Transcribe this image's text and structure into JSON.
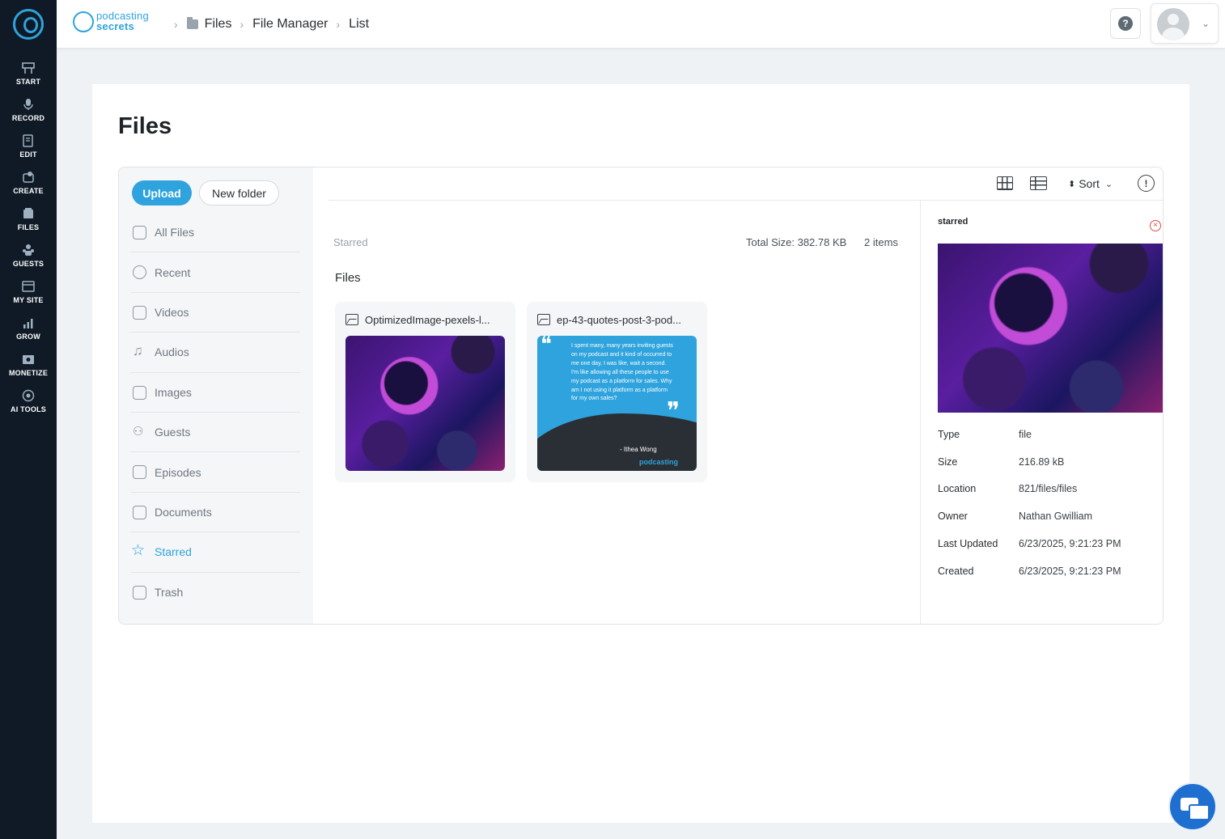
{
  "rail": {
    "items": [
      {
        "label": "START",
        "icon": "start-icon"
      },
      {
        "label": "RECORD",
        "icon": "microphone-icon"
      },
      {
        "label": "EDIT",
        "icon": "edit-icon"
      },
      {
        "label": "CREATE",
        "icon": "create-icon"
      },
      {
        "label": "FILES",
        "icon": "files-icon"
      },
      {
        "label": "GUESTS",
        "icon": "guests-icon"
      },
      {
        "label": "MY SITE",
        "icon": "site-icon"
      },
      {
        "label": "GROW",
        "icon": "chart-icon"
      },
      {
        "label": "MONETIZE",
        "icon": "monetize-icon"
      },
      {
        "label": "AI TOOLS",
        "icon": "ai-tools-icon"
      }
    ]
  },
  "brand": {
    "line1": "podcasting",
    "line2": "secrets"
  },
  "breadcrumb": {
    "items": [
      "Files",
      "File Manager",
      "List"
    ]
  },
  "header": {
    "help_glyph": "?",
    "user_chevron": "⌄"
  },
  "page": {
    "title": "Files"
  },
  "sidebar": {
    "upload_label": "Upload",
    "new_folder_label": "New folder",
    "items": [
      {
        "label": "All Files",
        "icon": "folder-icon"
      },
      {
        "label": "Recent",
        "icon": "clock-icon"
      },
      {
        "label": "Videos",
        "icon": "video-icon"
      },
      {
        "label": "Audios",
        "icon": "music-note-icon"
      },
      {
        "label": "Images",
        "icon": "image-icon"
      },
      {
        "label": "Guests",
        "icon": "people-icon"
      },
      {
        "label": "Episodes",
        "icon": "episodes-icon"
      },
      {
        "label": "Documents",
        "icon": "document-icon"
      },
      {
        "label": "Starred",
        "icon": "star-icon",
        "active": true
      },
      {
        "label": "Trash",
        "icon": "trash-icon"
      }
    ]
  },
  "toolbar": {
    "sort_label": "Sort",
    "info_glyph": "!"
  },
  "content": {
    "location_label": "Starred",
    "total_size": "Total Size: 382.78 KB",
    "item_count": "2 items",
    "section_title": "Files",
    "files": [
      {
        "name": "OptimizedImage-pexels-l...",
        "thumb": "gaming"
      },
      {
        "name": "ep-43-quotes-post-3-pod...",
        "thumb": "quote",
        "quote_text": "I spent many, many years inviting guests on my podcast and it kind of occurred to me one day, I was like, wait a second. I'm like allowing all these people to use my podcast as a platform for sales. Why am I not using it platform as a platform for my own sales?",
        "quote_author": "- Ithea Wong",
        "quote_brand": "podcasting"
      }
    ]
  },
  "details": {
    "title": "starred",
    "close_glyph": "×",
    "rows": [
      {
        "key": "Type",
        "value": "file"
      },
      {
        "key": "Size",
        "value": "216.89 kB"
      },
      {
        "key": "Location",
        "value": "821/files/files"
      },
      {
        "key": "Owner",
        "value": "Nathan Gwilliam"
      },
      {
        "key": "Last Updated",
        "value": "6/23/2025, 9:21:23 PM"
      },
      {
        "key": "Created",
        "value": "6/23/2025, 9:21:23 PM"
      }
    ]
  },
  "colors": {
    "accent": "#2ea3dd",
    "rail_bg": "#0f1a26",
    "chat": "#1f6fd1"
  }
}
